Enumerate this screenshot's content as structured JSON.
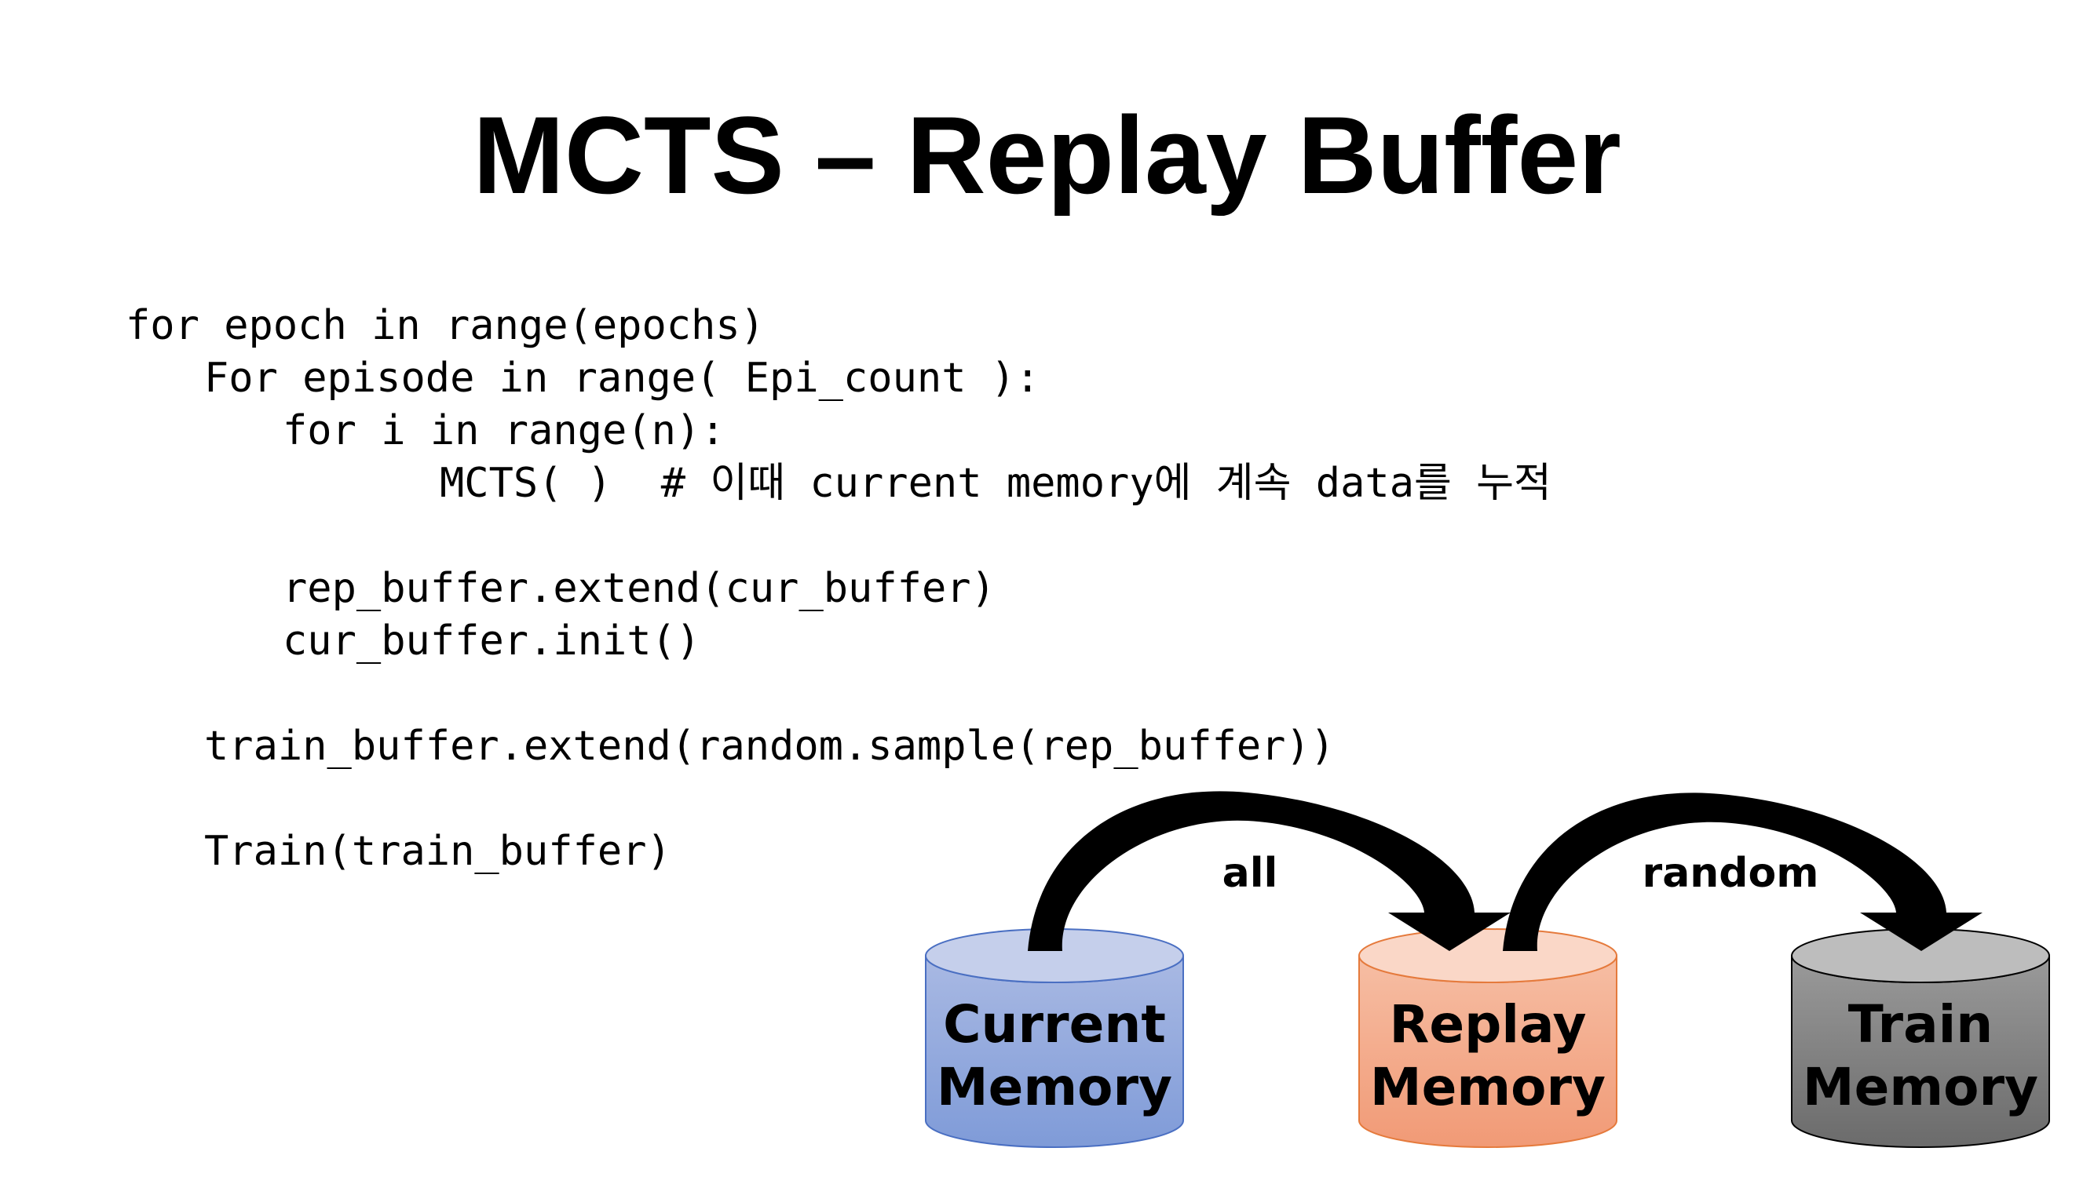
{
  "title": "MCTS – Replay Buffer",
  "code": [
    {
      "text": "for epoch in range(epochs)",
      "indent": 0
    },
    {
      "text": "For episode in range( Epi_count ):",
      "indent": 1
    },
    {
      "text": "for i in range(n):",
      "indent": 2
    },
    {
      "text": "MCTS( )  # 이때 current memory에 계속 data를 누적",
      "indent": 4
    },
    {
      "text": "",
      "indent": 0
    },
    {
      "text": "rep_buffer.extend(cur_buffer)",
      "indent": 2
    },
    {
      "text": "cur_buffer.init()",
      "indent": 2
    },
    {
      "text": "",
      "indent": 0
    },
    {
      "text": "train_buffer.extend(random.sample(rep_buffer))",
      "indent": 1
    },
    {
      "text": "",
      "indent": 0
    },
    {
      "text": "Train(train_buffer)",
      "indent": 1
    }
  ],
  "diagram": {
    "nodes": [
      {
        "label_line1": "Current",
        "label_line2": "Memory",
        "color_top": "#c5cfeb",
        "color_body_top": "#a9b9e3",
        "color_body_bottom": "#7f9bd8",
        "stroke": "#4a6fc2"
      },
      {
        "label_line1": "Replay",
        "label_line2": "Memory",
        "color_top": "#fad7c7",
        "color_body_top": "#f6bea4",
        "color_body_bottom": "#f19a76",
        "stroke": "#e57a3c"
      },
      {
        "label_line1": "Train",
        "label_line2": "Memory",
        "color_top": "#bdbdbd",
        "color_body_top": "#9a9a9a",
        "color_body_bottom": "#6b6b6b",
        "stroke": "#000000"
      }
    ],
    "edges": [
      {
        "from": 0,
        "to": 1,
        "label": "all"
      },
      {
        "from": 1,
        "to": 2,
        "label": "random"
      }
    ]
  }
}
